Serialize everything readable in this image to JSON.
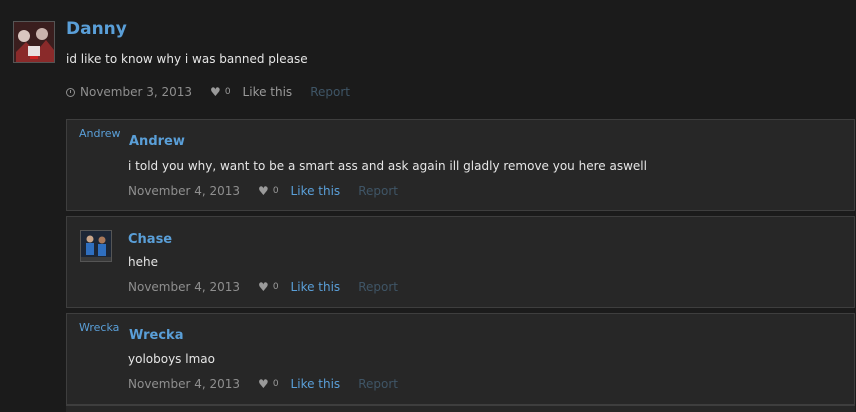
{
  "post": {
    "author": "Danny",
    "body": "id like to know why i was banned please",
    "date": "November 3, 2013",
    "likes": "0",
    "like_label": "Like this",
    "report_label": "Report"
  },
  "comments": [
    {
      "avatar_text": "Andrew",
      "author": "Andrew",
      "body": "i told you why, want to be a smart ass and ask again ill gladly remove you here aswell",
      "date": "November 4, 2013",
      "likes": "0",
      "like_label": "Like this",
      "report_label": "Report"
    },
    {
      "author": "Chase",
      "body": "hehe",
      "date": "November 4, 2013",
      "likes": "0",
      "like_label": "Like this",
      "report_label": "Report"
    },
    {
      "avatar_text": "Wrecka",
      "author": "Wrecka",
      "body": "yoloboys lmao",
      "date": "November 4, 2013",
      "likes": "0",
      "like_label": "Like this",
      "report_label": "Report"
    }
  ],
  "colors": {
    "background": "#1b1b1b",
    "link": "#5a9fd8",
    "comment_bg": "#272727",
    "report": "#3f5566"
  }
}
